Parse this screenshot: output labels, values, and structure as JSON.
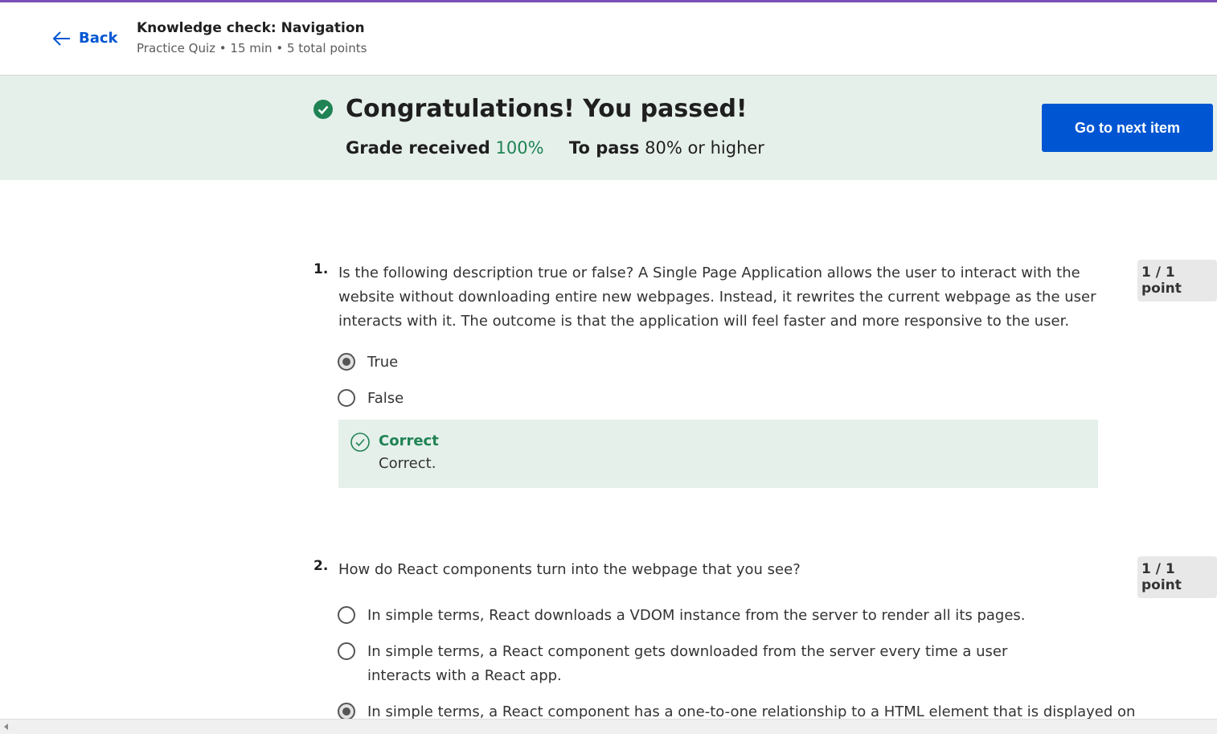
{
  "header": {
    "back_label": "Back",
    "title": "Knowledge check: Navigation",
    "subtitle": "Practice Quiz • 15 min • 5 total points"
  },
  "banner": {
    "congrats": "Congratulations! You passed!",
    "grade_label": "Grade received",
    "grade_value": "100%",
    "pass_label": "To pass",
    "pass_value": "80% or higher",
    "next_button": "Go to next item"
  },
  "questions": [
    {
      "number": "1.",
      "text": "Is the following description true or false? A Single Page Application allows the user to interact with the website without downloading entire new webpages. Instead, it rewrites the current webpage as the user interacts with it. The outcome is that the application will feel faster and more responsive to the user.",
      "points": "1 / 1 point",
      "options": [
        {
          "label": "True",
          "selected": true
        },
        {
          "label": "False",
          "selected": false
        }
      ],
      "feedback": {
        "title": "Correct",
        "body": "Correct."
      }
    },
    {
      "number": "2.",
      "text": "How do React components turn into the webpage that you see?",
      "points": "1 / 1 point",
      "options": [
        {
          "label": "In simple terms, React downloads a VDOM instance from the server to render all its pages.",
          "selected": false
        },
        {
          "label": "In simple terms, a React component gets downloaded from the server every time a user interacts with a React app.",
          "selected": false
        },
        {
          "label": "In simple terms, a React component has a one-to-one relationship to a HTML element that is displayed on",
          "selected": true
        }
      ]
    }
  ],
  "colors": {
    "accent": "#0056d2",
    "success": "#1f8354",
    "banner_bg": "#e6f0eb",
    "top_stripe": "#7b4fb7"
  }
}
